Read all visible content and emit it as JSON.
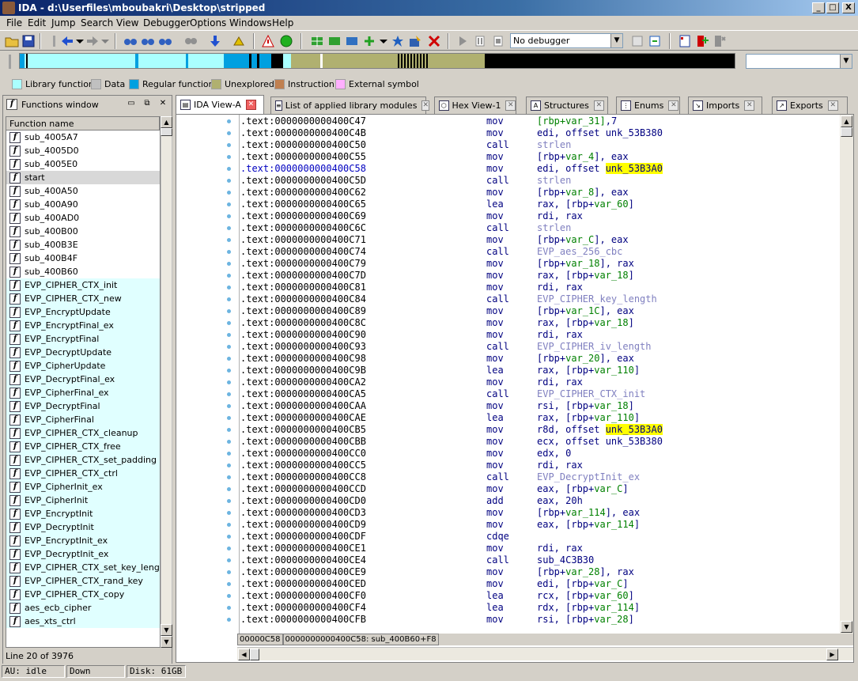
{
  "window": {
    "title": "IDA - d:\\Userfiles\\mboubakri\\Desktop\\stripped",
    "min_label": "_",
    "max_label": "□",
    "close_label": "X"
  },
  "menu": [
    "File",
    "Edit",
    "Jump",
    "Search",
    "View",
    "Debugger",
    "Options",
    "Windows",
    "Help"
  ],
  "toolbar": {
    "debugger_select": "No debugger"
  },
  "legend": [
    {
      "label": "Library function",
      "color": "#aaffff"
    },
    {
      "label": "Data",
      "color": "#c0c0c0"
    },
    {
      "label": "Regular function",
      "color": "#00a0e0"
    },
    {
      "label": "Unexplored",
      "color": "#b0b070"
    },
    {
      "label": "Instruction",
      "color": "#c08050"
    },
    {
      "label": "External symbol",
      "color": "#ffb0ff"
    }
  ],
  "functions_window": {
    "title": "Functions window",
    "column_header": "Function name",
    "status": "Line 20 of 3976",
    "items": [
      {
        "name": "sub_4005A7",
        "lib": false
      },
      {
        "name": "sub_4005D0",
        "lib": false
      },
      {
        "name": "sub_4005E0",
        "lib": false
      },
      {
        "name": "start",
        "lib": false,
        "selected": true
      },
      {
        "name": "sub_400A50",
        "lib": false
      },
      {
        "name": "sub_400A90",
        "lib": false
      },
      {
        "name": "sub_400AD0",
        "lib": false
      },
      {
        "name": "sub_400B00",
        "lib": false
      },
      {
        "name": "sub_400B3E",
        "lib": false
      },
      {
        "name": "sub_400B4F",
        "lib": false
      },
      {
        "name": "sub_400B60",
        "lib": false
      },
      {
        "name": "EVP_CIPHER_CTX_init",
        "lib": true
      },
      {
        "name": "EVP_CIPHER_CTX_new",
        "lib": true
      },
      {
        "name": "EVP_EncryptUpdate",
        "lib": true
      },
      {
        "name": "EVP_EncryptFinal_ex",
        "lib": true
      },
      {
        "name": "EVP_EncryptFinal",
        "lib": true
      },
      {
        "name": "EVP_DecryptUpdate",
        "lib": true
      },
      {
        "name": "EVP_CipherUpdate",
        "lib": true
      },
      {
        "name": "EVP_DecryptFinal_ex",
        "lib": true
      },
      {
        "name": "EVP_CipherFinal_ex",
        "lib": true
      },
      {
        "name": "EVP_DecryptFinal",
        "lib": true
      },
      {
        "name": "EVP_CipherFinal",
        "lib": true
      },
      {
        "name": "EVP_CIPHER_CTX_cleanup",
        "lib": true
      },
      {
        "name": "EVP_CIPHER_CTX_free",
        "lib": true
      },
      {
        "name": "EVP_CIPHER_CTX_set_padding",
        "lib": true
      },
      {
        "name": "EVP_CIPHER_CTX_ctrl",
        "lib": true
      },
      {
        "name": "EVP_CipherInit_ex",
        "lib": true
      },
      {
        "name": "EVP_CipherInit",
        "lib": true
      },
      {
        "name": "EVP_EncryptInit",
        "lib": true
      },
      {
        "name": "EVP_DecryptInit",
        "lib": true
      },
      {
        "name": "EVP_EncryptInit_ex",
        "lib": true
      },
      {
        "name": "EVP_DecryptInit_ex",
        "lib": true
      },
      {
        "name": "EVP_CIPHER_CTX_set_key_length",
        "lib": true
      },
      {
        "name": "EVP_CIPHER_CTX_rand_key",
        "lib": true
      },
      {
        "name": "EVP_CIPHER_CTX_copy",
        "lib": true
      },
      {
        "name": "aes_ecb_cipher",
        "lib": true
      },
      {
        "name": "aes_xts_ctrl",
        "lib": true
      }
    ]
  },
  "tabs": [
    {
      "label": "IDA View-A",
      "active": true,
      "icon": "document-icon"
    },
    {
      "label": "List of applied library modules",
      "active": false,
      "icon": "list-icon"
    },
    {
      "label": "Hex View-1",
      "active": false,
      "icon": "hex-icon"
    },
    {
      "label": "Structures",
      "active": false,
      "icon": "structures-icon"
    },
    {
      "label": "Enums",
      "active": false,
      "icon": "enums-icon"
    },
    {
      "label": "Imports",
      "active": false,
      "icon": "imports-icon"
    },
    {
      "label": "Exports",
      "active": false,
      "icon": "exports-icon"
    }
  ],
  "disasm": {
    "lines": [
      {
        "addr": ".text:0000000000400C47",
        "mn": "mov",
        "op": [
          [
            "var",
            "[rbp+var_31]"
          ],
          [
            "",
            ","
          ],
          [
            "",
            "7"
          ]
        ]
      },
      {
        "addr": ".text:0000000000400C4B",
        "mn": "mov",
        "op": [
          [
            "",
            "edi, offset unk_53B380"
          ]
        ]
      },
      {
        "addr": ".text:0000000000400C50",
        "mn": "call",
        "op": [
          [
            "fn",
            "strlen"
          ]
        ]
      },
      {
        "addr": ".text:0000000000400C55",
        "mn": "mov",
        "op": [
          [
            "",
            "[rbp+"
          ],
          [
            "var",
            "var_4"
          ],
          [
            "",
            "], eax"
          ]
        ]
      },
      {
        "addr": ".text:0000000000400C58",
        "mn": "mov",
        "cur": true,
        "op": [
          [
            "",
            "edi, offset "
          ],
          [
            "hl",
            "unk_53B3A0"
          ]
        ]
      },
      {
        "addr": ".text:0000000000400C5D",
        "mn": "call",
        "op": [
          [
            "fn",
            "strlen"
          ]
        ]
      },
      {
        "addr": ".text:0000000000400C62",
        "mn": "mov",
        "op": [
          [
            "",
            "[rbp+"
          ],
          [
            "var",
            "var_8"
          ],
          [
            "",
            "], eax"
          ]
        ]
      },
      {
        "addr": ".text:0000000000400C65",
        "mn": "lea",
        "op": [
          [
            "",
            "rax, [rbp+"
          ],
          [
            "var",
            "var_60"
          ],
          [
            "",
            "]"
          ]
        ]
      },
      {
        "addr": ".text:0000000000400C69",
        "mn": "mov",
        "op": [
          [
            "",
            "rdi, rax"
          ]
        ]
      },
      {
        "addr": ".text:0000000000400C6C",
        "mn": "call",
        "op": [
          [
            "fn",
            "strlen"
          ]
        ]
      },
      {
        "addr": ".text:0000000000400C71",
        "mn": "mov",
        "op": [
          [
            "",
            "[rbp+"
          ],
          [
            "var",
            "var_C"
          ],
          [
            "",
            "], eax"
          ]
        ]
      },
      {
        "addr": ".text:0000000000400C74",
        "mn": "call",
        "op": [
          [
            "fn",
            "EVP_aes_256_cbc"
          ]
        ]
      },
      {
        "addr": ".text:0000000000400C79",
        "mn": "mov",
        "op": [
          [
            "",
            "[rbp+"
          ],
          [
            "var",
            "var_18"
          ],
          [
            "",
            "], rax"
          ]
        ]
      },
      {
        "addr": ".text:0000000000400C7D",
        "mn": "mov",
        "op": [
          [
            "",
            "rax, [rbp+"
          ],
          [
            "var",
            "var_18"
          ],
          [
            "",
            "]"
          ]
        ]
      },
      {
        "addr": ".text:0000000000400C81",
        "mn": "mov",
        "op": [
          [
            "",
            "rdi, rax"
          ]
        ]
      },
      {
        "addr": ".text:0000000000400C84",
        "mn": "call",
        "op": [
          [
            "fn",
            "EVP_CIPHER_key_length"
          ]
        ]
      },
      {
        "addr": ".text:0000000000400C89",
        "mn": "mov",
        "op": [
          [
            "",
            "[rbp+"
          ],
          [
            "var",
            "var_1C"
          ],
          [
            "",
            "], eax"
          ]
        ]
      },
      {
        "addr": ".text:0000000000400C8C",
        "mn": "mov",
        "op": [
          [
            "",
            "rax, [rbp+"
          ],
          [
            "var",
            "var_18"
          ],
          [
            "",
            "]"
          ]
        ]
      },
      {
        "addr": ".text:0000000000400C90",
        "mn": "mov",
        "op": [
          [
            "",
            "rdi, rax"
          ]
        ]
      },
      {
        "addr": ".text:0000000000400C93",
        "mn": "call",
        "op": [
          [
            "fn",
            "EVP_CIPHER_iv_length"
          ]
        ]
      },
      {
        "addr": ".text:0000000000400C98",
        "mn": "mov",
        "op": [
          [
            "",
            "[rbp+"
          ],
          [
            "var",
            "var_20"
          ],
          [
            "",
            "], eax"
          ]
        ]
      },
      {
        "addr": ".text:0000000000400C9B",
        "mn": "lea",
        "op": [
          [
            "",
            "rax, [rbp+"
          ],
          [
            "var",
            "var_110"
          ],
          [
            "",
            "]"
          ]
        ]
      },
      {
        "addr": ".text:0000000000400CA2",
        "mn": "mov",
        "op": [
          [
            "",
            "rdi, rax"
          ]
        ]
      },
      {
        "addr": ".text:0000000000400CA5",
        "mn": "call",
        "op": [
          [
            "fn",
            "EVP_CIPHER_CTX_init"
          ]
        ]
      },
      {
        "addr": ".text:0000000000400CAA",
        "mn": "mov",
        "op": [
          [
            "",
            "rsi, [rbp+"
          ],
          [
            "var",
            "var_18"
          ],
          [
            "",
            "]"
          ]
        ]
      },
      {
        "addr": ".text:0000000000400CAE",
        "mn": "lea",
        "op": [
          [
            "",
            "rax, [rbp+"
          ],
          [
            "var",
            "var_110"
          ],
          [
            "",
            "]"
          ]
        ]
      },
      {
        "addr": ".text:0000000000400CB5",
        "mn": "mov",
        "op": [
          [
            "",
            "r8d, offset "
          ],
          [
            "hl",
            "unk_53B3A0"
          ]
        ]
      },
      {
        "addr": ".text:0000000000400CBB",
        "mn": "mov",
        "op": [
          [
            "",
            "ecx, offset unk_53B380"
          ]
        ]
      },
      {
        "addr": ".text:0000000000400CC0",
        "mn": "mov",
        "op": [
          [
            "",
            "edx, 0"
          ]
        ]
      },
      {
        "addr": ".text:0000000000400CC5",
        "mn": "mov",
        "op": [
          [
            "",
            "rdi, rax"
          ]
        ]
      },
      {
        "addr": ".text:0000000000400CC8",
        "mn": "call",
        "op": [
          [
            "fn",
            "EVP_DecryptInit_ex"
          ]
        ]
      },
      {
        "addr": ".text:0000000000400CCD",
        "mn": "mov",
        "op": [
          [
            "",
            "eax, [rbp+"
          ],
          [
            "var",
            "var_C"
          ],
          [
            "",
            "]"
          ]
        ]
      },
      {
        "addr": ".text:0000000000400CD0",
        "mn": "add",
        "op": [
          [
            "",
            "eax, 20h"
          ]
        ]
      },
      {
        "addr": ".text:0000000000400CD3",
        "mn": "mov",
        "op": [
          [
            "",
            "[rbp+"
          ],
          [
            "var",
            "var_114"
          ],
          [
            "",
            "], eax"
          ]
        ]
      },
      {
        "addr": ".text:0000000000400CD9",
        "mn": "mov",
        "op": [
          [
            "",
            "eax, [rbp+"
          ],
          [
            "var",
            "var_114"
          ],
          [
            "",
            "]"
          ]
        ]
      },
      {
        "addr": ".text:0000000000400CDF",
        "mn": "cdqe",
        "op": []
      },
      {
        "addr": ".text:0000000000400CE1",
        "mn": "mov",
        "op": [
          [
            "",
            "rdi, rax"
          ]
        ]
      },
      {
        "addr": ".text:0000000000400CE4",
        "mn": "call",
        "op": [
          [
            "",
            "sub_4C3B30"
          ]
        ]
      },
      {
        "addr": ".text:0000000000400CE9",
        "mn": "mov",
        "op": [
          [
            "",
            "[rbp+"
          ],
          [
            "var",
            "var_28"
          ],
          [
            "",
            "], rax"
          ]
        ]
      },
      {
        "addr": ".text:0000000000400CED",
        "mn": "mov",
        "op": [
          [
            "",
            "edi, [rbp+"
          ],
          [
            "var",
            "var_C"
          ],
          [
            "",
            "]"
          ]
        ]
      },
      {
        "addr": ".text:0000000000400CF0",
        "mn": "lea",
        "op": [
          [
            "",
            "rcx, [rbp+"
          ],
          [
            "var",
            "var_60"
          ],
          [
            "",
            "]"
          ]
        ]
      },
      {
        "addr": ".text:0000000000400CF4",
        "mn": "lea",
        "op": [
          [
            "",
            "rdx, [rbp+"
          ],
          [
            "var",
            "var_114"
          ],
          [
            "",
            "]"
          ]
        ]
      },
      {
        "addr": ".text:0000000000400CFB",
        "mn": "mov",
        "op": [
          [
            "",
            "rsi, [rbp+"
          ],
          [
            "var",
            "var_28"
          ],
          [
            "",
            "]"
          ]
        ]
      }
    ],
    "addr_short": "00000C58",
    "addr_location": "0000000000400C58: sub_400B60+F8"
  },
  "status": {
    "au": "AU:  idle",
    "direction": "Down",
    "disk": "Disk: 61GB"
  }
}
